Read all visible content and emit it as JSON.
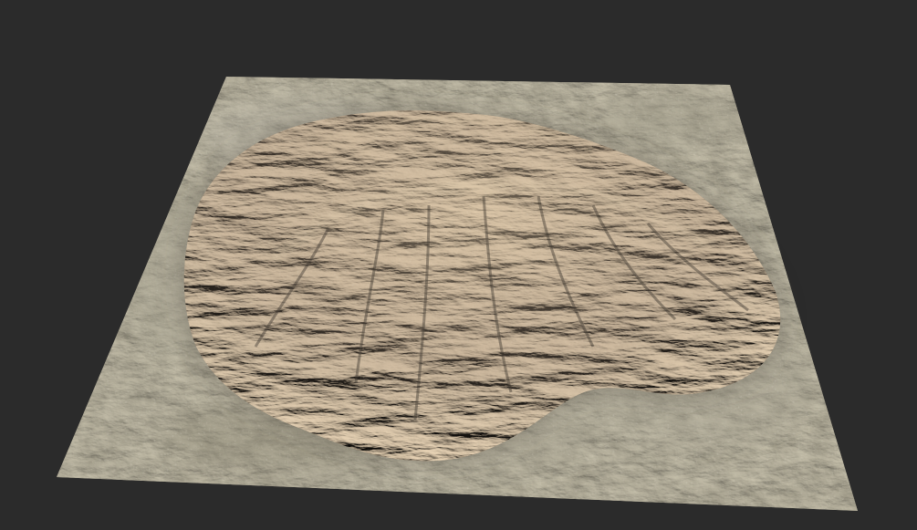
{
  "scene": {
    "background_color": "#2b2b2b",
    "subject": "terrain-mesh",
    "palette": {
      "plain": "#7a7562",
      "plain_dark": "#5f5a4a",
      "plain_light": "#9a9480",
      "rock": "#8a7866",
      "rock_light": "#c2ab8e",
      "ridge_highlight": "#d8c4a4",
      "shadow": "#3e3830",
      "wash": "#b8b4a6"
    }
  }
}
